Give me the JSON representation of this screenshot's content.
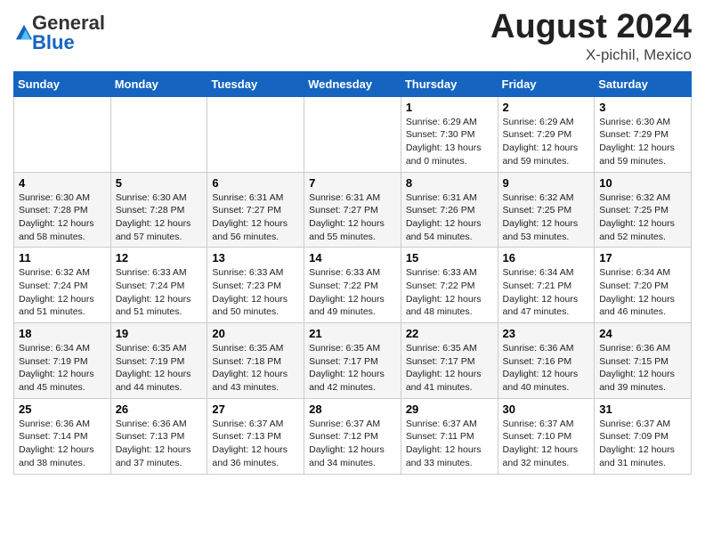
{
  "header": {
    "logo_general": "General",
    "logo_blue": "Blue",
    "month_year": "August 2024",
    "location": "X-pichil, Mexico"
  },
  "weekdays": [
    "Sunday",
    "Monday",
    "Tuesday",
    "Wednesday",
    "Thursday",
    "Friday",
    "Saturday"
  ],
  "weeks": [
    [
      {
        "day": "",
        "info": ""
      },
      {
        "day": "",
        "info": ""
      },
      {
        "day": "",
        "info": ""
      },
      {
        "day": "",
        "info": ""
      },
      {
        "day": "1",
        "info": "Sunrise: 6:29 AM\nSunset: 7:30 PM\nDaylight: 13 hours\nand 0 minutes."
      },
      {
        "day": "2",
        "info": "Sunrise: 6:29 AM\nSunset: 7:29 PM\nDaylight: 12 hours\nand 59 minutes."
      },
      {
        "day": "3",
        "info": "Sunrise: 6:30 AM\nSunset: 7:29 PM\nDaylight: 12 hours\nand 59 minutes."
      }
    ],
    [
      {
        "day": "4",
        "info": "Sunrise: 6:30 AM\nSunset: 7:28 PM\nDaylight: 12 hours\nand 58 minutes."
      },
      {
        "day": "5",
        "info": "Sunrise: 6:30 AM\nSunset: 7:28 PM\nDaylight: 12 hours\nand 57 minutes."
      },
      {
        "day": "6",
        "info": "Sunrise: 6:31 AM\nSunset: 7:27 PM\nDaylight: 12 hours\nand 56 minutes."
      },
      {
        "day": "7",
        "info": "Sunrise: 6:31 AM\nSunset: 7:27 PM\nDaylight: 12 hours\nand 55 minutes."
      },
      {
        "day": "8",
        "info": "Sunrise: 6:31 AM\nSunset: 7:26 PM\nDaylight: 12 hours\nand 54 minutes."
      },
      {
        "day": "9",
        "info": "Sunrise: 6:32 AM\nSunset: 7:25 PM\nDaylight: 12 hours\nand 53 minutes."
      },
      {
        "day": "10",
        "info": "Sunrise: 6:32 AM\nSunset: 7:25 PM\nDaylight: 12 hours\nand 52 minutes."
      }
    ],
    [
      {
        "day": "11",
        "info": "Sunrise: 6:32 AM\nSunset: 7:24 PM\nDaylight: 12 hours\nand 51 minutes."
      },
      {
        "day": "12",
        "info": "Sunrise: 6:33 AM\nSunset: 7:24 PM\nDaylight: 12 hours\nand 51 minutes."
      },
      {
        "day": "13",
        "info": "Sunrise: 6:33 AM\nSunset: 7:23 PM\nDaylight: 12 hours\nand 50 minutes."
      },
      {
        "day": "14",
        "info": "Sunrise: 6:33 AM\nSunset: 7:22 PM\nDaylight: 12 hours\nand 49 minutes."
      },
      {
        "day": "15",
        "info": "Sunrise: 6:33 AM\nSunset: 7:22 PM\nDaylight: 12 hours\nand 48 minutes."
      },
      {
        "day": "16",
        "info": "Sunrise: 6:34 AM\nSunset: 7:21 PM\nDaylight: 12 hours\nand 47 minutes."
      },
      {
        "day": "17",
        "info": "Sunrise: 6:34 AM\nSunset: 7:20 PM\nDaylight: 12 hours\nand 46 minutes."
      }
    ],
    [
      {
        "day": "18",
        "info": "Sunrise: 6:34 AM\nSunset: 7:19 PM\nDaylight: 12 hours\nand 45 minutes."
      },
      {
        "day": "19",
        "info": "Sunrise: 6:35 AM\nSunset: 7:19 PM\nDaylight: 12 hours\nand 44 minutes."
      },
      {
        "day": "20",
        "info": "Sunrise: 6:35 AM\nSunset: 7:18 PM\nDaylight: 12 hours\nand 43 minutes."
      },
      {
        "day": "21",
        "info": "Sunrise: 6:35 AM\nSunset: 7:17 PM\nDaylight: 12 hours\nand 42 minutes."
      },
      {
        "day": "22",
        "info": "Sunrise: 6:35 AM\nSunset: 7:17 PM\nDaylight: 12 hours\nand 41 minutes."
      },
      {
        "day": "23",
        "info": "Sunrise: 6:36 AM\nSunset: 7:16 PM\nDaylight: 12 hours\nand 40 minutes."
      },
      {
        "day": "24",
        "info": "Sunrise: 6:36 AM\nSunset: 7:15 PM\nDaylight: 12 hours\nand 39 minutes."
      }
    ],
    [
      {
        "day": "25",
        "info": "Sunrise: 6:36 AM\nSunset: 7:14 PM\nDaylight: 12 hours\nand 38 minutes."
      },
      {
        "day": "26",
        "info": "Sunrise: 6:36 AM\nSunset: 7:13 PM\nDaylight: 12 hours\nand 37 minutes."
      },
      {
        "day": "27",
        "info": "Sunrise: 6:37 AM\nSunset: 7:13 PM\nDaylight: 12 hours\nand 36 minutes."
      },
      {
        "day": "28",
        "info": "Sunrise: 6:37 AM\nSunset: 7:12 PM\nDaylight: 12 hours\nand 34 minutes."
      },
      {
        "day": "29",
        "info": "Sunrise: 6:37 AM\nSunset: 7:11 PM\nDaylight: 12 hours\nand 33 minutes."
      },
      {
        "day": "30",
        "info": "Sunrise: 6:37 AM\nSunset: 7:10 PM\nDaylight: 12 hours\nand 32 minutes."
      },
      {
        "day": "31",
        "info": "Sunrise: 6:37 AM\nSunset: 7:09 PM\nDaylight: 12 hours\nand 31 minutes."
      }
    ]
  ]
}
